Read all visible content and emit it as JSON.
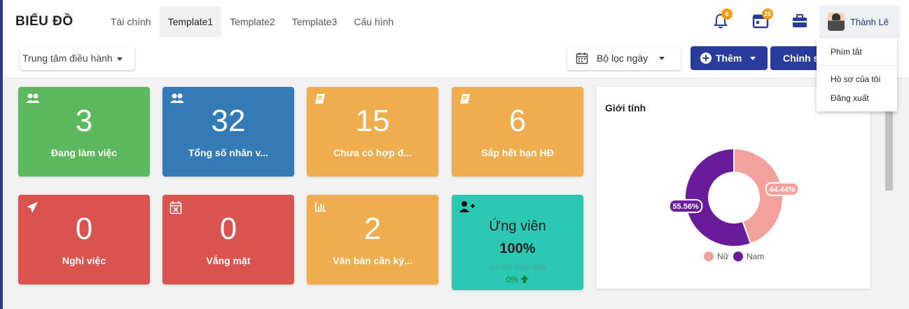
{
  "brand": "BIỂU ĐỒ",
  "nav": {
    "tabs": [
      "Tài chính",
      "Template1",
      "Template2",
      "Template3",
      "Cấu hình"
    ],
    "active_index": 1
  },
  "header": {
    "notification_count": "6",
    "calendar_count": "25",
    "user_name": "Thành Lê"
  },
  "toolbar": {
    "center_select": "Trung tâm điều hành",
    "date_filter": "Bộ lọc ngày",
    "add_label": "Thêm",
    "edit_label": "Chỉnh sửa"
  },
  "cards": [
    {
      "value": "3",
      "label": "Đang làm việc",
      "color": "#5cb85c",
      "icon": "users-icon"
    },
    {
      "value": "32",
      "label": "Tổng số nhân v...",
      "color": "#337ab7",
      "icon": "users-icon"
    },
    {
      "value": "15",
      "label": "Chưa có hợp đ...",
      "color": "#f0ad4e",
      "icon": "book-icon"
    },
    {
      "value": "6",
      "label": "Sắp hết hạn HĐ",
      "color": "#f0ad4e",
      "icon": "book-icon"
    },
    {
      "value": "0",
      "label": "Nghỉ việc",
      "color": "#d9534f",
      "icon": "paper-plane-icon"
    },
    {
      "value": "0",
      "label": "Vắng mặt",
      "color": "#d9534f",
      "icon": "calendar-x-icon"
    },
    {
      "value": "2",
      "label": "Văn bản cần ký...",
      "color": "#f0ad4e",
      "icon": "bar-chart-icon"
    }
  ],
  "candidate_card": {
    "title": "Ứng viên",
    "percent": "100%",
    "subtitle": "so với mục tiêu",
    "growth": "0%",
    "color": "#2bc9b4",
    "icon": "user-plus-icon"
  },
  "chart_data": {
    "type": "pie",
    "title": "Giới tính",
    "donut": true,
    "categories": [
      "Nữ",
      "Nam"
    ],
    "values": [
      44.44,
      55.56
    ],
    "labels": [
      "44.44%",
      "55.56%"
    ],
    "colors": [
      "#f4a09c",
      "#6a1b9a"
    ],
    "legend_position": "bottom"
  },
  "user_menu": {
    "items": [
      "Phím tắt",
      "Hồ sơ của tôi",
      "Đăng xuất"
    ]
  }
}
